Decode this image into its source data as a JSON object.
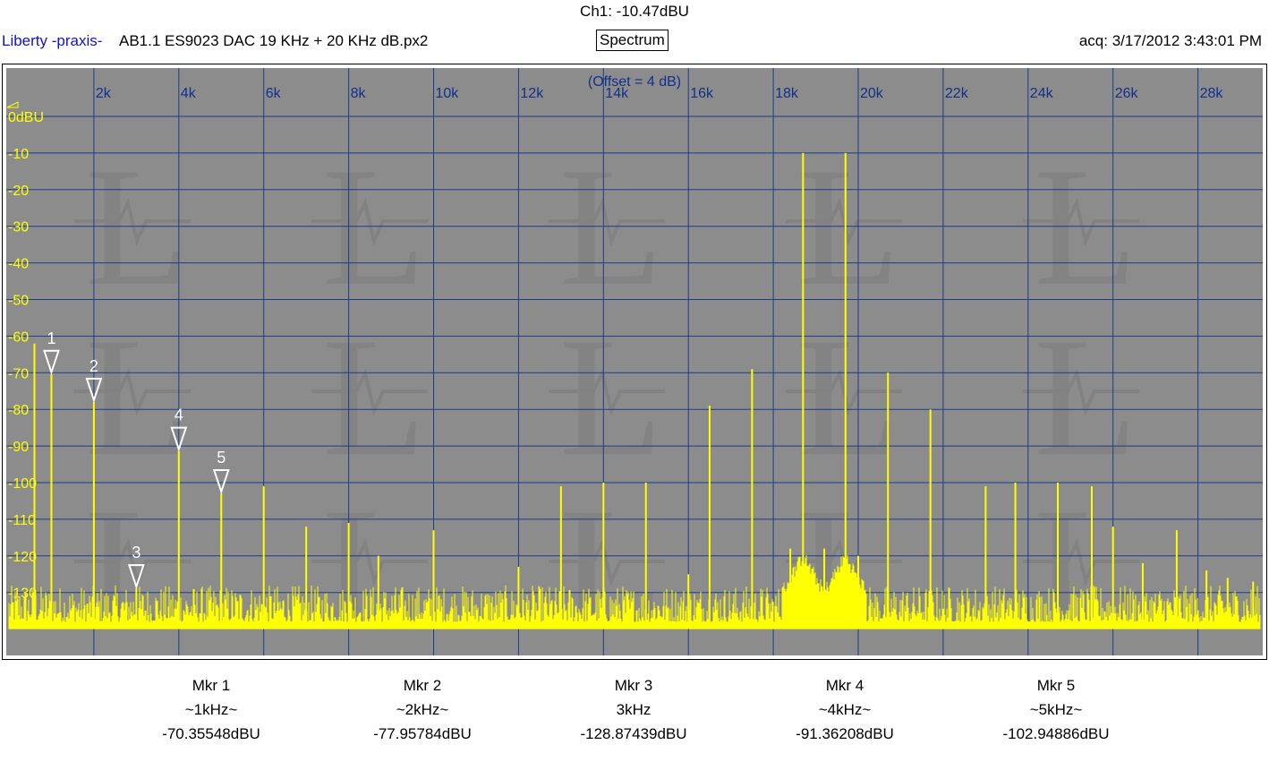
{
  "header": {
    "channel_readout": "Ch1: -10.47dBU",
    "source": "Liberty -praxis-",
    "filename": "AB1.1 ES9023 DAC 19 KHz + 20 KHz dB.px2",
    "view_button": "Spectrum",
    "acquired": "acq: 3/17/2012 3:43:01 PM"
  },
  "colors": {
    "plot_bg": "#8c8c8c",
    "grid": "#1a3c8a",
    "trace": "#ffff00",
    "axis_label_x": "#10308c",
    "axis_label_y": "#ffff00",
    "marker": "#ffffff",
    "header_source": "#1212c8"
  },
  "chart_data": {
    "type": "line",
    "title": "",
    "offset_note": "(Offset = 4 dB)",
    "xlabel": "",
    "ylabel": "",
    "xlim": [
      0,
      30000
    ],
    "ylim": [
      -140,
      0
    ],
    "x_ticks": [
      {
        "value": 2000,
        "label": "2k"
      },
      {
        "value": 4000,
        "label": "4k"
      },
      {
        "value": 6000,
        "label": "6k"
      },
      {
        "value": 8000,
        "label": "8k"
      },
      {
        "value": 10000,
        "label": "10k"
      },
      {
        "value": 12000,
        "label": "12k"
      },
      {
        "value": 14000,
        "label": "14k"
      },
      {
        "value": 16000,
        "label": "16k"
      },
      {
        "value": 18000,
        "label": "18k"
      },
      {
        "value": 20000,
        "label": "20k"
      },
      {
        "value": 22000,
        "label": "22k"
      },
      {
        "value": 24000,
        "label": "24k"
      },
      {
        "value": 26000,
        "label": "26k"
      },
      {
        "value": 28000,
        "label": "28k"
      }
    ],
    "y_ticks": [
      {
        "value": 0,
        "label": "0dBU"
      },
      {
        "value": -10,
        "label": "-10"
      },
      {
        "value": -20,
        "label": "-20"
      },
      {
        "value": -30,
        "label": "-30"
      },
      {
        "value": -40,
        "label": "-40"
      },
      {
        "value": -50,
        "label": "-50"
      },
      {
        "value": -60,
        "label": "-60"
      },
      {
        "value": -70,
        "label": "-70"
      },
      {
        "value": -80,
        "label": "-80"
      },
      {
        "value": -90,
        "label": "-90"
      },
      {
        "value": -100,
        "label": "-100"
      },
      {
        "value": -110,
        "label": "-110"
      },
      {
        "value": -120,
        "label": "-120"
      },
      {
        "value": -130,
        "label": "-130"
      }
    ],
    "grid": true,
    "noise_floor_db": [
      -138,
      -128
    ],
    "peaks": [
      {
        "x": 600,
        "y": -62
      },
      {
        "x": 1000,
        "y": -70.4
      },
      {
        "x": 2000,
        "y": -78
      },
      {
        "x": 3000,
        "y": -128.9
      },
      {
        "x": 4000,
        "y": -91.4
      },
      {
        "x": 5000,
        "y": -102.9
      },
      {
        "x": 6000,
        "y": -101
      },
      {
        "x": 7000,
        "y": -112
      },
      {
        "x": 8000,
        "y": -111
      },
      {
        "x": 8700,
        "y": -120
      },
      {
        "x": 10000,
        "y": -113
      },
      {
        "x": 12000,
        "y": -123
      },
      {
        "x": 13000,
        "y": -101
      },
      {
        "x": 14000,
        "y": -100
      },
      {
        "x": 15000,
        "y": -100
      },
      {
        "x": 16000,
        "y": -125
      },
      {
        "x": 16500,
        "y": -79
      },
      {
        "x": 17500,
        "y": -69
      },
      {
        "x": 18400,
        "y": -118
      },
      {
        "x": 18700,
        "y": -10
      },
      {
        "x": 19200,
        "y": -118
      },
      {
        "x": 19700,
        "y": -10
      },
      {
        "x": 20000,
        "y": -120
      },
      {
        "x": 20700,
        "y": -70
      },
      {
        "x": 21700,
        "y": -80
      },
      {
        "x": 23000,
        "y": -101
      },
      {
        "x": 23700,
        "y": -100
      },
      {
        "x": 24700,
        "y": -100
      },
      {
        "x": 25500,
        "y": -101
      },
      {
        "x": 26000,
        "y": -112
      },
      {
        "x": 26700,
        "y": -122
      },
      {
        "x": 27500,
        "y": -113
      },
      {
        "x": 28200,
        "y": -124
      },
      {
        "x": 28700,
        "y": -126
      },
      {
        "x": 29300,
        "y": -127
      }
    ],
    "markers": [
      {
        "id": "1",
        "x": 1000,
        "y": -70.35548,
        "name": "Mkr 1",
        "freq": "~1kHz~",
        "value": "-70.35548dBU"
      },
      {
        "id": "2",
        "x": 2000,
        "y": -77.95784,
        "name": "Mkr 2",
        "freq": "~2kHz~",
        "value": "-77.95784dBU"
      },
      {
        "id": "3",
        "x": 3000,
        "y": -128.87439,
        "name": "Mkr 3",
        "freq": "3kHz",
        "value": "-128.87439dBU"
      },
      {
        "id": "4",
        "x": 4000,
        "y": -91.36208,
        "name": "Mkr 4",
        "freq": "~4kHz~",
        "value": "-91.36208dBU"
      },
      {
        "id": "5",
        "x": 5000,
        "y": -102.94886,
        "name": "Mkr 5",
        "freq": "~5kHz~",
        "value": "-102.94886dBU"
      }
    ]
  }
}
